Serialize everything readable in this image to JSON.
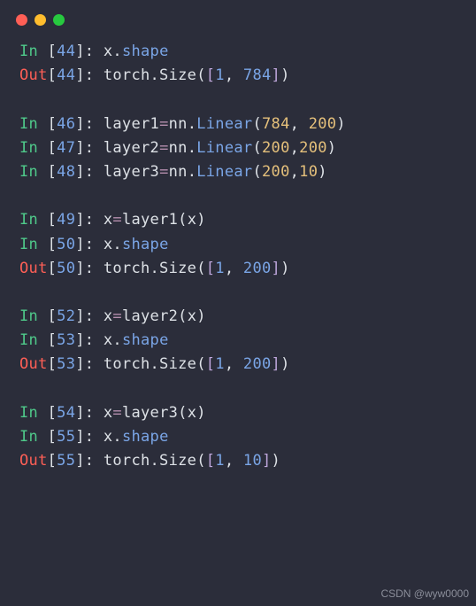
{
  "colors": {
    "bg": "#2b2d3a",
    "red": "#ff5f56",
    "yellow": "#ffbd2e",
    "green": "#27c93f"
  },
  "watermark": "CSDN @wyw0000",
  "prompts": {
    "in": "In ",
    "out": "Out"
  },
  "lines": [
    {
      "kind": "in",
      "n": "44",
      "tokens": [
        [
          "c-var",
          "x"
        ],
        [
          "c-dot",
          "."
        ],
        [
          "c-attr",
          "shape"
        ]
      ]
    },
    {
      "kind": "out",
      "n": "44",
      "tokens": [
        [
          "o-torch",
          "torch.Size("
        ],
        [
          "o-br",
          "["
        ],
        [
          "o-num",
          "1"
        ],
        [
          "o-torch",
          ", "
        ],
        [
          "o-num",
          "784"
        ],
        [
          "o-br",
          "]"
        ],
        [
          "o-torch",
          ")"
        ]
      ]
    },
    {
      "kind": "blank"
    },
    {
      "kind": "in",
      "n": "46",
      "tokens": [
        [
          "c-name",
          "layer1"
        ],
        [
          "c-eq",
          "="
        ],
        [
          "c-module",
          "nn"
        ],
        [
          "c-dot",
          "."
        ],
        [
          "c-class",
          "Linear"
        ],
        [
          "c-paren",
          "("
        ],
        [
          "c-num",
          "784"
        ],
        [
          "c-comma",
          ", "
        ],
        [
          "c-num",
          "200"
        ],
        [
          "c-paren",
          ")"
        ]
      ]
    },
    {
      "kind": "in",
      "n": "47",
      "tokens": [
        [
          "c-name",
          "layer2"
        ],
        [
          "c-eq",
          "="
        ],
        [
          "c-module",
          "nn"
        ],
        [
          "c-dot",
          "."
        ],
        [
          "c-class",
          "Linear"
        ],
        [
          "c-paren",
          "("
        ],
        [
          "c-num",
          "200"
        ],
        [
          "c-comma",
          ","
        ],
        [
          "c-num",
          "200"
        ],
        [
          "c-paren",
          ")"
        ]
      ]
    },
    {
      "kind": "in",
      "n": "48",
      "tokens": [
        [
          "c-name",
          "layer3"
        ],
        [
          "c-eq",
          "="
        ],
        [
          "c-module",
          "nn"
        ],
        [
          "c-dot",
          "."
        ],
        [
          "c-class",
          "Linear"
        ],
        [
          "c-paren",
          "("
        ],
        [
          "c-num",
          "200"
        ],
        [
          "c-comma",
          ","
        ],
        [
          "c-num",
          "10"
        ],
        [
          "c-paren",
          ")"
        ]
      ]
    },
    {
      "kind": "blank"
    },
    {
      "kind": "in",
      "n": "49",
      "tokens": [
        [
          "c-name",
          "x"
        ],
        [
          "c-eq",
          "="
        ],
        [
          "c-name",
          "layer1"
        ],
        [
          "c-paren",
          "("
        ],
        [
          "c-var",
          "x"
        ],
        [
          "c-paren",
          ")"
        ]
      ]
    },
    {
      "kind": "in",
      "n": "50",
      "tokens": [
        [
          "c-var",
          "x"
        ],
        [
          "c-dot",
          "."
        ],
        [
          "c-attr",
          "shape"
        ]
      ]
    },
    {
      "kind": "out",
      "n": "50",
      "tokens": [
        [
          "o-torch",
          "torch.Size("
        ],
        [
          "o-br",
          "["
        ],
        [
          "o-num",
          "1"
        ],
        [
          "o-torch",
          ", "
        ],
        [
          "o-num",
          "200"
        ],
        [
          "o-br",
          "]"
        ],
        [
          "o-torch",
          ")"
        ]
      ]
    },
    {
      "kind": "blank"
    },
    {
      "kind": "in",
      "n": "52",
      "tokens": [
        [
          "c-name",
          "x"
        ],
        [
          "c-eq",
          "="
        ],
        [
          "c-name",
          "layer2"
        ],
        [
          "c-paren",
          "("
        ],
        [
          "c-var",
          "x"
        ],
        [
          "c-paren",
          ")"
        ]
      ]
    },
    {
      "kind": "in",
      "n": "53",
      "tokens": [
        [
          "c-var",
          "x"
        ],
        [
          "c-dot",
          "."
        ],
        [
          "c-attr",
          "shape"
        ]
      ]
    },
    {
      "kind": "out",
      "n": "53",
      "tokens": [
        [
          "o-torch",
          "torch.Size("
        ],
        [
          "o-br",
          "["
        ],
        [
          "o-num",
          "1"
        ],
        [
          "o-torch",
          ", "
        ],
        [
          "o-num",
          "200"
        ],
        [
          "o-br",
          "]"
        ],
        [
          "o-torch",
          ")"
        ]
      ]
    },
    {
      "kind": "blank"
    },
    {
      "kind": "in",
      "n": "54",
      "tokens": [
        [
          "c-name",
          "x"
        ],
        [
          "c-eq",
          "="
        ],
        [
          "c-name",
          "layer3"
        ],
        [
          "c-paren",
          "("
        ],
        [
          "c-var",
          "x"
        ],
        [
          "c-paren",
          ")"
        ]
      ]
    },
    {
      "kind": "in",
      "n": "55",
      "tokens": [
        [
          "c-var",
          "x"
        ],
        [
          "c-dot",
          "."
        ],
        [
          "c-attr",
          "shape"
        ]
      ]
    },
    {
      "kind": "out",
      "n": "55",
      "tokens": [
        [
          "o-torch",
          "torch.Size("
        ],
        [
          "o-br",
          "["
        ],
        [
          "o-num",
          "1"
        ],
        [
          "o-torch",
          ", "
        ],
        [
          "o-num",
          "10"
        ],
        [
          "o-br",
          "]"
        ],
        [
          "o-torch",
          ")"
        ]
      ]
    }
  ]
}
